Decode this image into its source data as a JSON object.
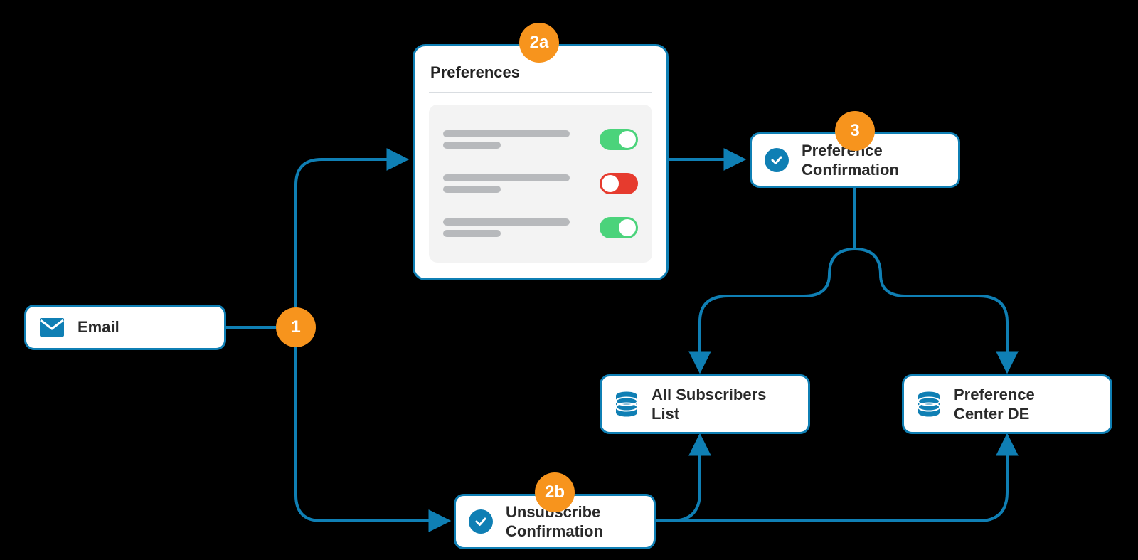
{
  "colors": {
    "accent": "#0f7fb4",
    "badge": "#f7941d",
    "toggleOn": "#4bd37b",
    "toggleOff": "#e63b2e"
  },
  "badges": {
    "one": "1",
    "twoA": "2a",
    "twoB": "2b",
    "three": "3"
  },
  "nodes": {
    "email": {
      "label": "Email"
    },
    "preferences": {
      "title": "Preferences",
      "toggles": [
        true,
        false,
        true
      ]
    },
    "prefConfirm": {
      "label": "Preference\nConfirmation"
    },
    "unsubConfirm": {
      "label": "Unsubscribe\nConfirmation"
    },
    "allSubs": {
      "label": "All Subscribers\nList"
    },
    "prefCenterDE": {
      "label": "Preference\nCenter DE"
    }
  }
}
